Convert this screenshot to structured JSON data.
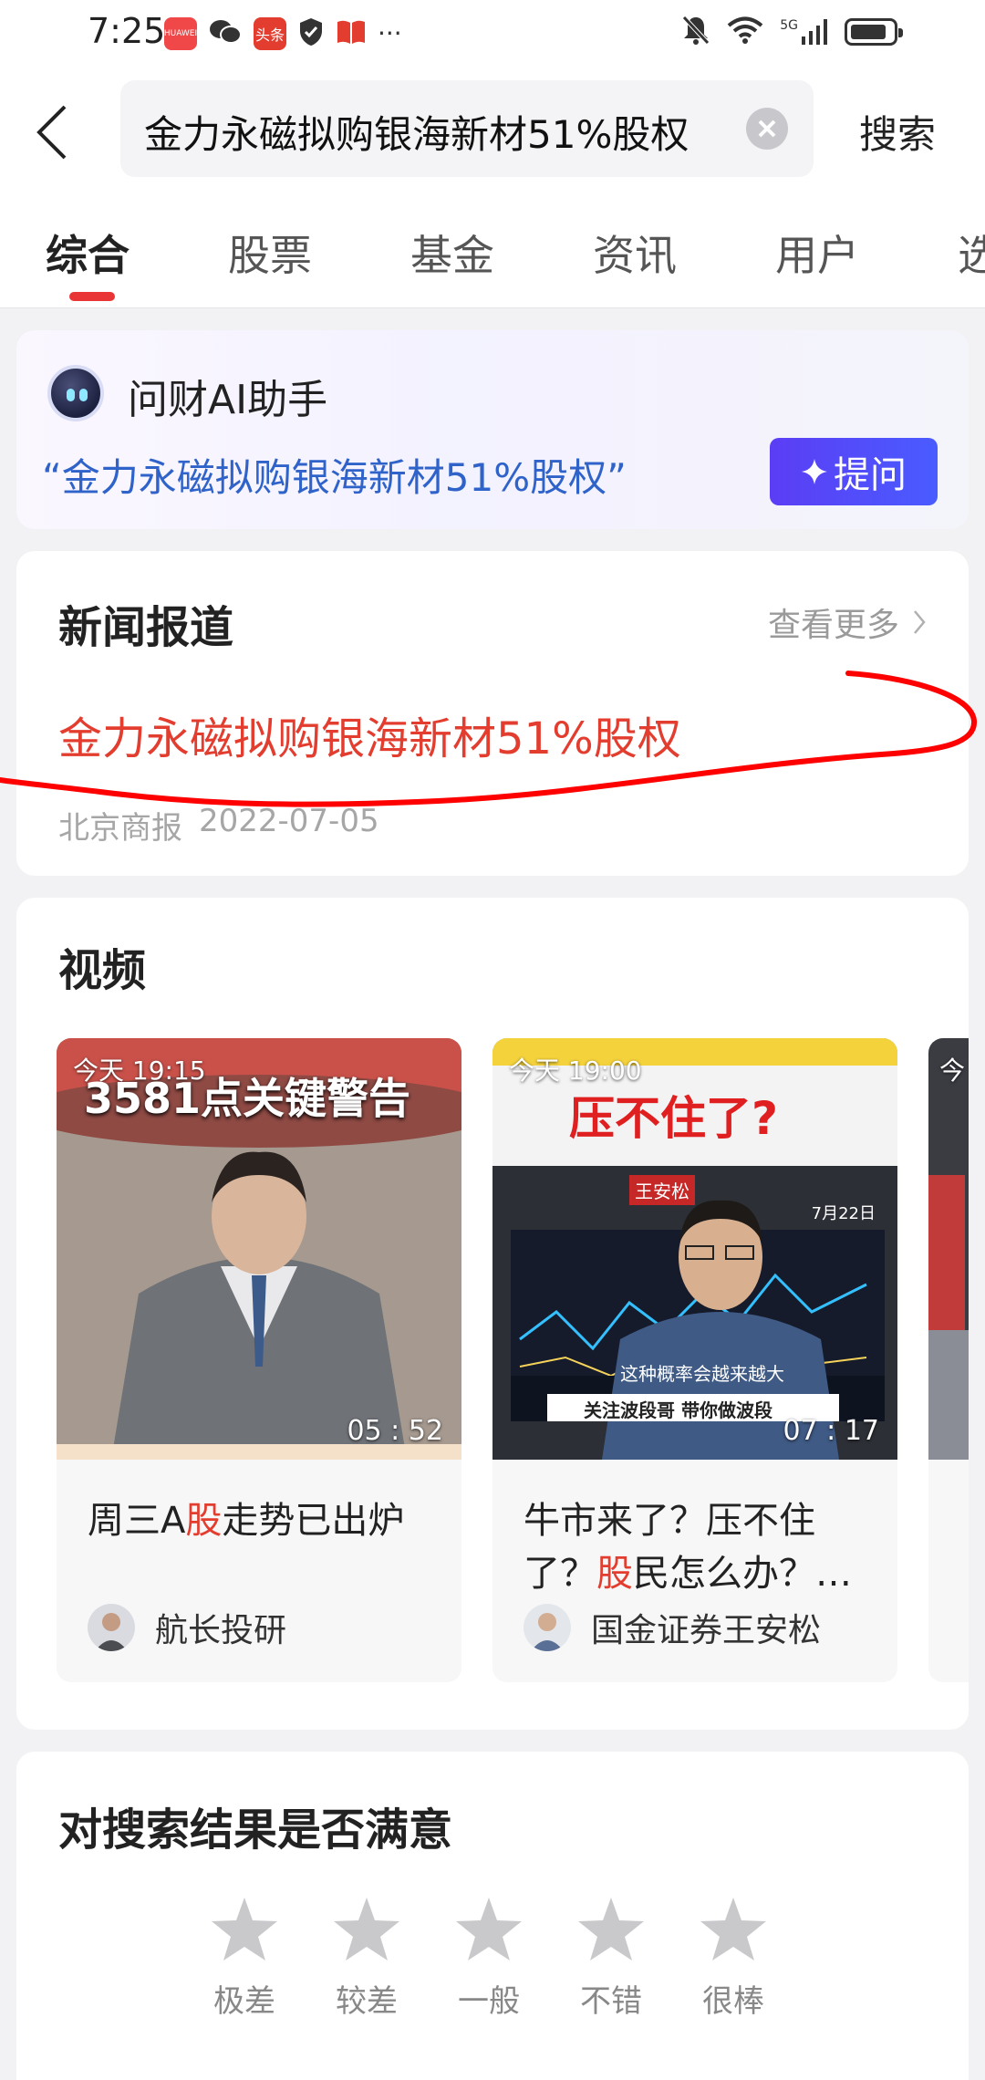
{
  "status_bar": {
    "time": "7:25",
    "apps": [
      {
        "name": "huawei-app-icon",
        "label": "HUAWEI",
        "color": "#f04848"
      },
      {
        "name": "wechat-icon",
        "label": "",
        "color": "#333333"
      },
      {
        "name": "toutiao-app-icon",
        "label": "头条",
        "color": "#e33d2f"
      },
      {
        "name": "shield-icon",
        "label": "",
        "color": "#333333"
      },
      {
        "name": "book-app-icon",
        "label": "",
        "color": "#e33d2f"
      }
    ],
    "more": "···",
    "network": "5G"
  },
  "search": {
    "query": "金力永磁拟购银海新材51%股权",
    "submit_label": "搜索"
  },
  "tabs": [
    "综合",
    "股票",
    "基金",
    "资讯",
    "用户",
    "选"
  ],
  "ai_assistant": {
    "title": "问财AI助手",
    "query": "“金力永磁拟购银海新材51%股权”",
    "ask_label": "提问"
  },
  "news": {
    "title": "新闻报道",
    "see_more": "查看更多",
    "headline": "金力永磁拟购银海新材51%股权",
    "source": "北京商报",
    "date": "2022-07-05"
  },
  "videos": {
    "title": "视频",
    "items": [
      {
        "time_label": "今天 19:15",
        "duration": "05 : 52",
        "overlay_text": "3581点关键警告",
        "title_before": "周三A",
        "title_highlight": "股",
        "title_after": "走势已出炉",
        "author": "航长投研"
      },
      {
        "time_label": "今天 19:00",
        "duration": "07 : 17",
        "overlay_text": "压不住了?",
        "caption_text": "这种概率会越来越大",
        "banner_text": "关注波段哥 带你做波段",
        "date_badge": "7月22日",
        "name_badge": "王安松",
        "title_before": "牛市来了？压不住了？",
        "title_highlight": "股",
        "title_after": "民怎么办？…",
        "author": "国金证券王安松"
      },
      {
        "time_label": "今",
        "duration": "",
        "title_before": "",
        "title_highlight": "",
        "title_after": "",
        "author": ""
      }
    ]
  },
  "feedback": {
    "title": "对搜索结果是否满意",
    "ratings": [
      "极差",
      "较差",
      "一般",
      "不错",
      "很棒"
    ]
  },
  "colors": {
    "accent_red": "#e33d2f",
    "link_blue": "#2f63c9",
    "ask_button": "#5b3df5",
    "annotation_red": "#ff0000"
  }
}
